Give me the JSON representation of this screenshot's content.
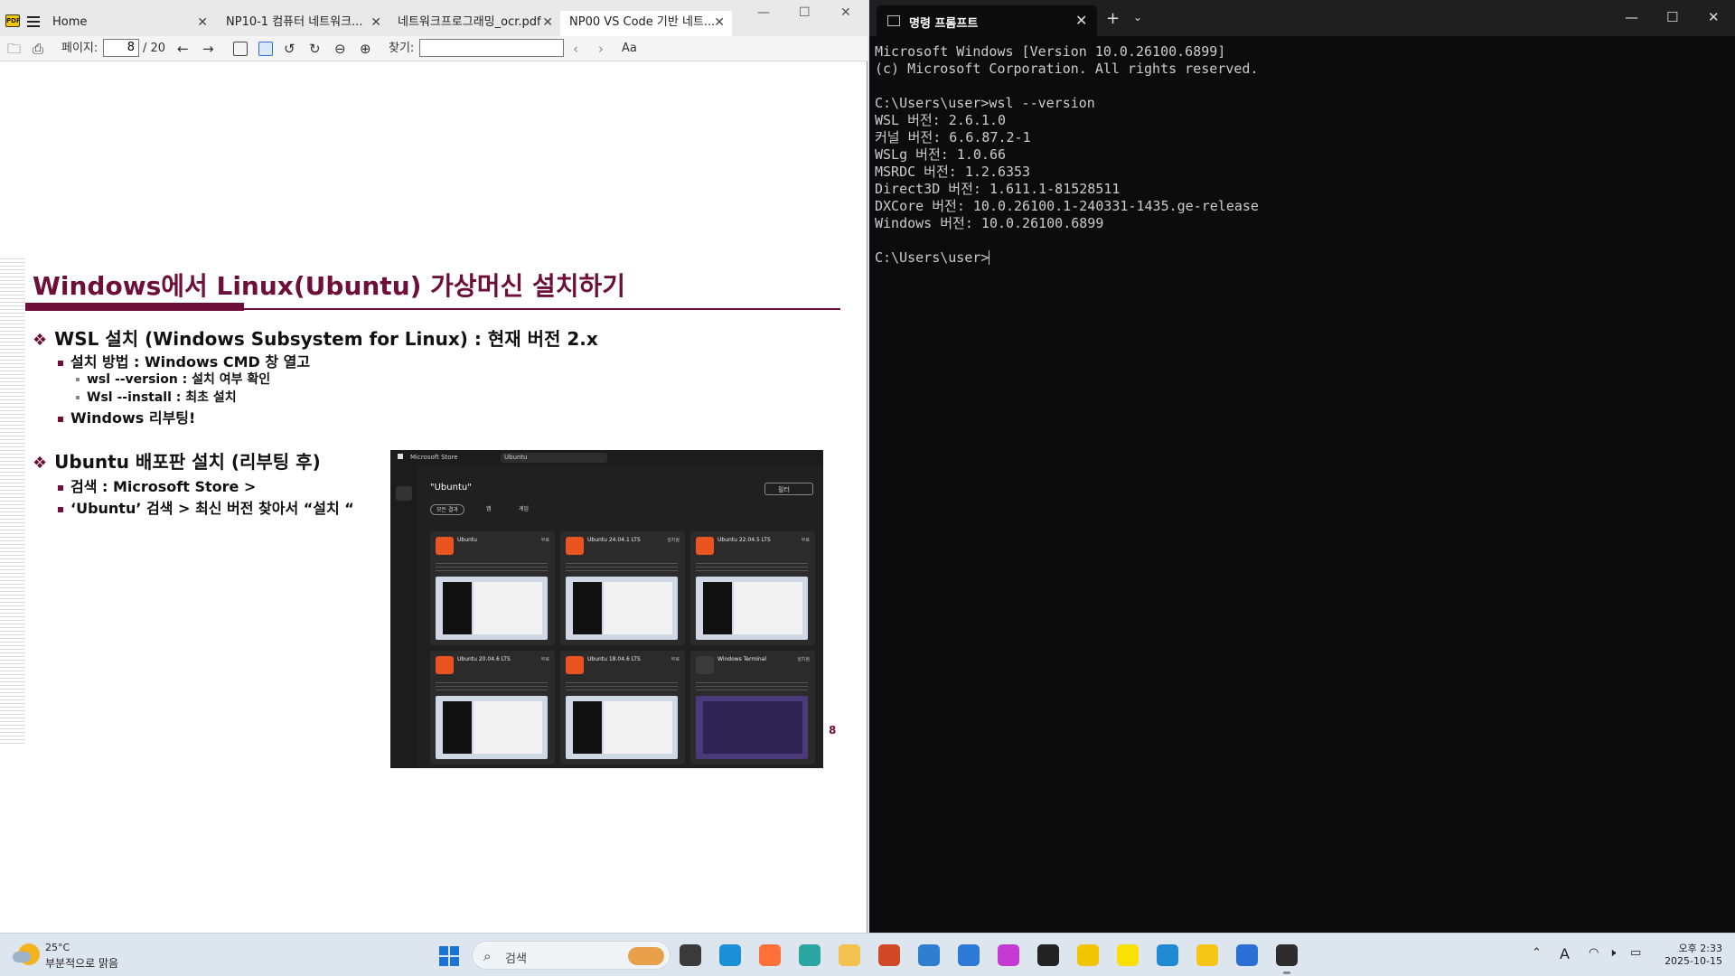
{
  "pdf": {
    "tabs": [
      {
        "label": "Home"
      },
      {
        "label": "NP10-1 컴퓨터 네트워크..."
      },
      {
        "label": "네트워크프로그래밍_ocr.pdf"
      },
      {
        "label": "NP00 VS Code 기반 네트..."
      }
    ],
    "toolbar": {
      "page_label": "페이지:",
      "page_value": "8",
      "page_total": "/ 20",
      "find_label": "찾기:",
      "find_value": "",
      "font_btn": "Aa"
    },
    "slide": {
      "title": "Windows에서 Linux(Ubuntu) 가상머신 설치하기",
      "bullet1": "WSL 설치 (Windows Subsystem for Linux) : 현재 버전 2.x",
      "bullet1_sub1": "설치 방법 : Windows CMD 창 열고",
      "bullet1_sub1_a": "wsl --version  : 설치 여부 확인",
      "bullet1_sub1_b": "Wsl --install : 최초 설치",
      "bullet1_sub2": "Windows 리부팅!",
      "bullet2": "Ubuntu 배포판 설치 (리부팅 후)",
      "bullet2_sub1": "검색 : Microsoft Store >",
      "bullet2_sub2": "‘Ubuntu’  검색 > 최신 버전 찾아서 “설치 “",
      "page_number": "8"
    },
    "store": {
      "app_name": "Microsoft Store",
      "search_value": "Ubuntu",
      "heading": "\"Ubuntu\"",
      "filter_label": "필터",
      "pills": [
        "모든 결과",
        "앱",
        "게임"
      ],
      "cards": [
        {
          "title": "Ubuntu",
          "badge": "무료"
        },
        {
          "title": "Ubuntu 24.04.1 LTS",
          "badge": "설치됨"
        },
        {
          "title": "Ubuntu 22.04.5 LTS",
          "badge": "무료"
        },
        {
          "title": "Ubuntu 20.04.6 LTS",
          "badge": "무료"
        },
        {
          "title": "Ubuntu 18.04.6 LTS",
          "badge": "무료"
        },
        {
          "title": "Windows Terminal",
          "badge": "설치됨"
        }
      ]
    }
  },
  "terminal": {
    "tab_label": "명령 프롬프트",
    "lines": [
      "Microsoft Windows [Version 10.0.26100.6899]",
      "(c) Microsoft Corporation. All rights reserved.",
      "",
      "C:\\Users\\user>wsl --version",
      "WSL 버전: 2.6.1.0",
      "커널 버전: 6.6.87.2-1",
      "WSLg 버전: 1.0.66",
      "MSRDC 버전: 1.2.6353",
      "Direct3D 버전: 1.611.1-81528511",
      "DXCore 버전: 10.0.26100.1-240331-1435.ge-release",
      "Windows 버전: 10.0.26100.6899",
      "",
      "C:\\Users\\user>"
    ]
  },
  "taskbar": {
    "weather_temp": "25°C",
    "weather_desc": "부분적으로 맑음",
    "search_placeholder": "검색",
    "tray_lang": "A",
    "clock_time": "오후 2:33",
    "clock_date": "2025-10-15",
    "apps": [
      {
        "icon": "file-explorer-icon",
        "color": "#3a3a3a"
      },
      {
        "icon": "edge-icon",
        "color": "#1b8fd8"
      },
      {
        "icon": "firefox-icon",
        "color": "#ff7139"
      },
      {
        "icon": "copilot-icon",
        "color": "#2aa6a1"
      },
      {
        "icon": "folder-icon",
        "color": "#f2c14e"
      },
      {
        "icon": "powerpoint-icon",
        "color": "#d24726"
      },
      {
        "icon": "app-icon",
        "color": "#2f7fd1"
      },
      {
        "icon": "notepad-icon",
        "color": "#2b7bd6"
      },
      {
        "icon": "snipping-tool-icon",
        "color": "#c23ad1"
      },
      {
        "icon": "notion-icon",
        "color": "#222222"
      },
      {
        "icon": "pdf-viewer-icon",
        "color": "#f2c500"
      },
      {
        "icon": "kakaotalk-icon",
        "color": "#f9e000"
      },
      {
        "icon": "vscode-icon",
        "color": "#1f8ad2"
      },
      {
        "icon": "media-player-icon",
        "color": "#f5c518"
      },
      {
        "icon": "arrow-app-icon",
        "color": "#2b6fd6"
      },
      {
        "icon": "terminal-icon",
        "color": "#2c2c2c"
      }
    ]
  }
}
